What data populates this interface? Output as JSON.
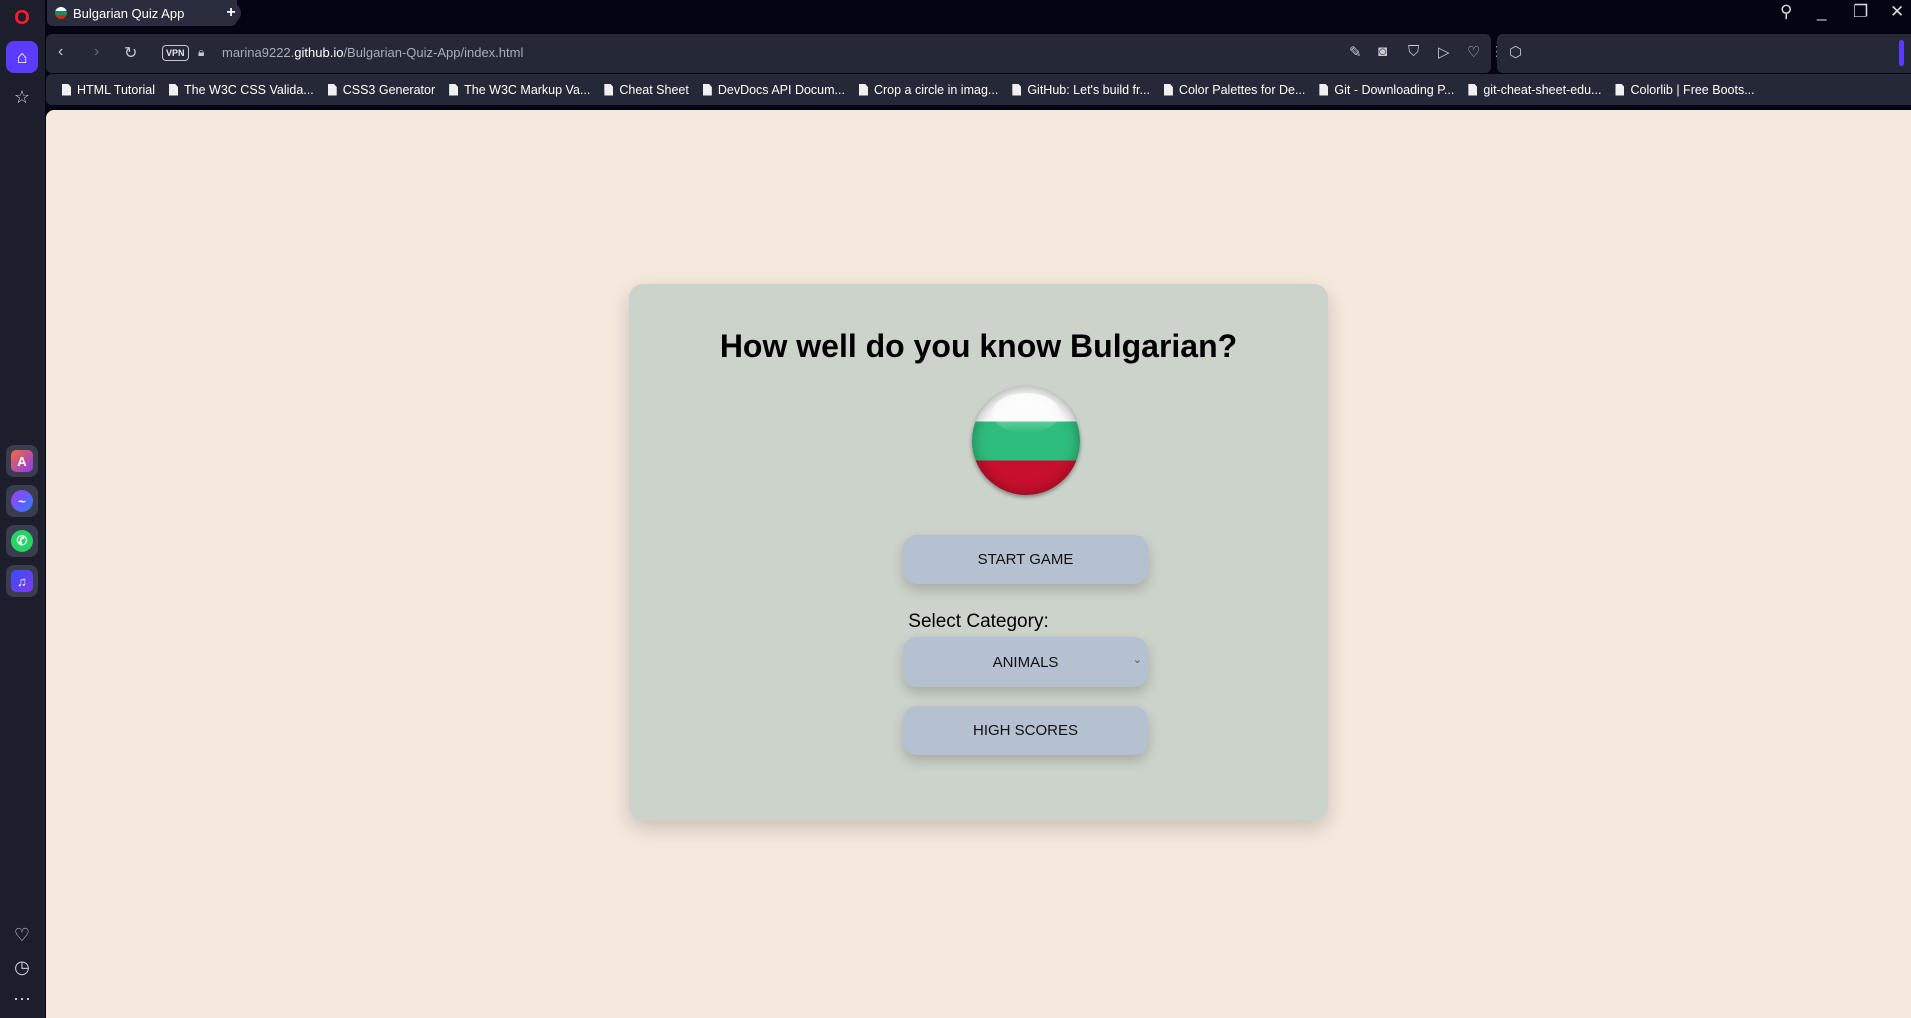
{
  "browser": {
    "tab_title": "Bulgarian Quiz App",
    "url_host_prefix": "marina9222.",
    "url_host_domain": "github.io",
    "url_path": "/Bulgarian-Quiz-App/index.html",
    "vpn_label": "VPN",
    "bookmarks": [
      "HTML Tutorial",
      "The W3C CSS Valida...",
      "CSS3 Generator",
      "The W3C Markup Va...",
      "Cheat Sheet",
      "DevDocs API Docum...",
      "Crop a circle in imag...",
      "GitHub: Let's build fr...",
      "Color Palettes for De...",
      "Git - Downloading P...",
      "git-cheat-sheet-edu...",
      "Colorlib | Free Boots..."
    ]
  },
  "quiz": {
    "title": "How well do you know Bulgarian?",
    "start_button": "START GAME",
    "category_label": "Select Category:",
    "category_selected": "ANIMALS",
    "high_scores_button": "HIGH SCORES"
  },
  "colors": {
    "page_bg": "#f5e9de",
    "card_bg": "#cbd3ca",
    "button_bg": "#b5c0d1",
    "accent": "#5b3cff"
  }
}
